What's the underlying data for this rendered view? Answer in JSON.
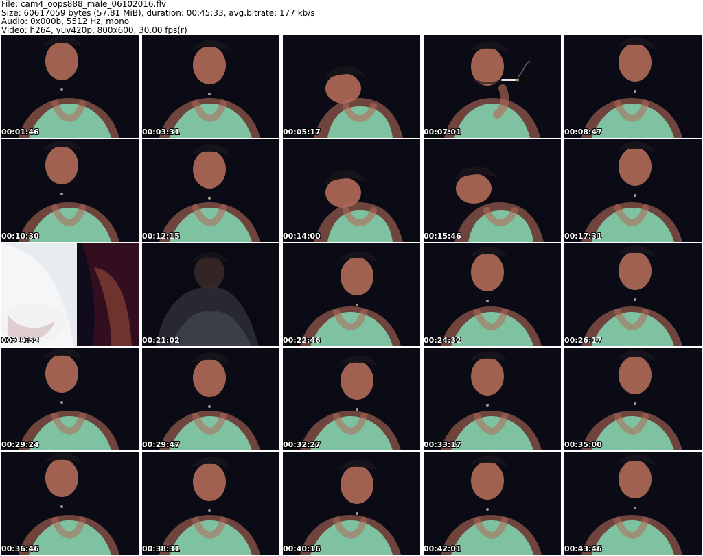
{
  "header": {
    "file_line": "File: cam4_oops888_male_06102016.flv",
    "size_line": "Size: 60617059 bytes (57.81 MiB), duration: 00:45:33, avg.bitrate: 177 kb/s",
    "audio_line": "Audio: 0x000b, 5512 Hz, mono",
    "video_line": "Video: h264, yuv420p, 800x600, 30.00 fps(r)"
  },
  "thumbnails": [
    {
      "time": "00:01:46",
      "variant": "tank"
    },
    {
      "time": "00:03:31",
      "variant": "tank"
    },
    {
      "time": "00:05:17",
      "variant": "lean"
    },
    {
      "time": "00:07:01",
      "variant": "smoke"
    },
    {
      "time": "00:08:47",
      "variant": "tank"
    },
    {
      "time": "00:10:30",
      "variant": "tank"
    },
    {
      "time": "00:12:15",
      "variant": "tank"
    },
    {
      "time": "00:14:00",
      "variant": "lean"
    },
    {
      "time": "00:15:46",
      "variant": "lean"
    },
    {
      "time": "00:17:31",
      "variant": "tank"
    },
    {
      "time": "00:19:52",
      "variant": "closeup"
    },
    {
      "time": "00:21:02",
      "variant": "dark"
    },
    {
      "time": "00:22:46",
      "variant": "tank"
    },
    {
      "time": "00:24:32",
      "variant": "tank"
    },
    {
      "time": "00:26:17",
      "variant": "tank"
    },
    {
      "time": "00:29:24",
      "variant": "tank"
    },
    {
      "time": "00:29:47",
      "variant": "tank"
    },
    {
      "time": "00:32:27",
      "variant": "tank"
    },
    {
      "time": "00:33:17",
      "variant": "tank"
    },
    {
      "time": "00:35:00",
      "variant": "tank"
    },
    {
      "time": "00:36:46",
      "variant": "tank"
    },
    {
      "time": "00:38:31",
      "variant": "tank"
    },
    {
      "time": "00:40:16",
      "variant": "tank"
    },
    {
      "time": "00:42:01",
      "variant": "tank"
    },
    {
      "time": "00:43:46",
      "variant": "tank"
    }
  ],
  "colors": {
    "background": "#ffffff",
    "frame_dark": "#0b0b16",
    "tank_top": "#7fc9a6",
    "skin": "#b06a58",
    "hair": "#16131b"
  }
}
